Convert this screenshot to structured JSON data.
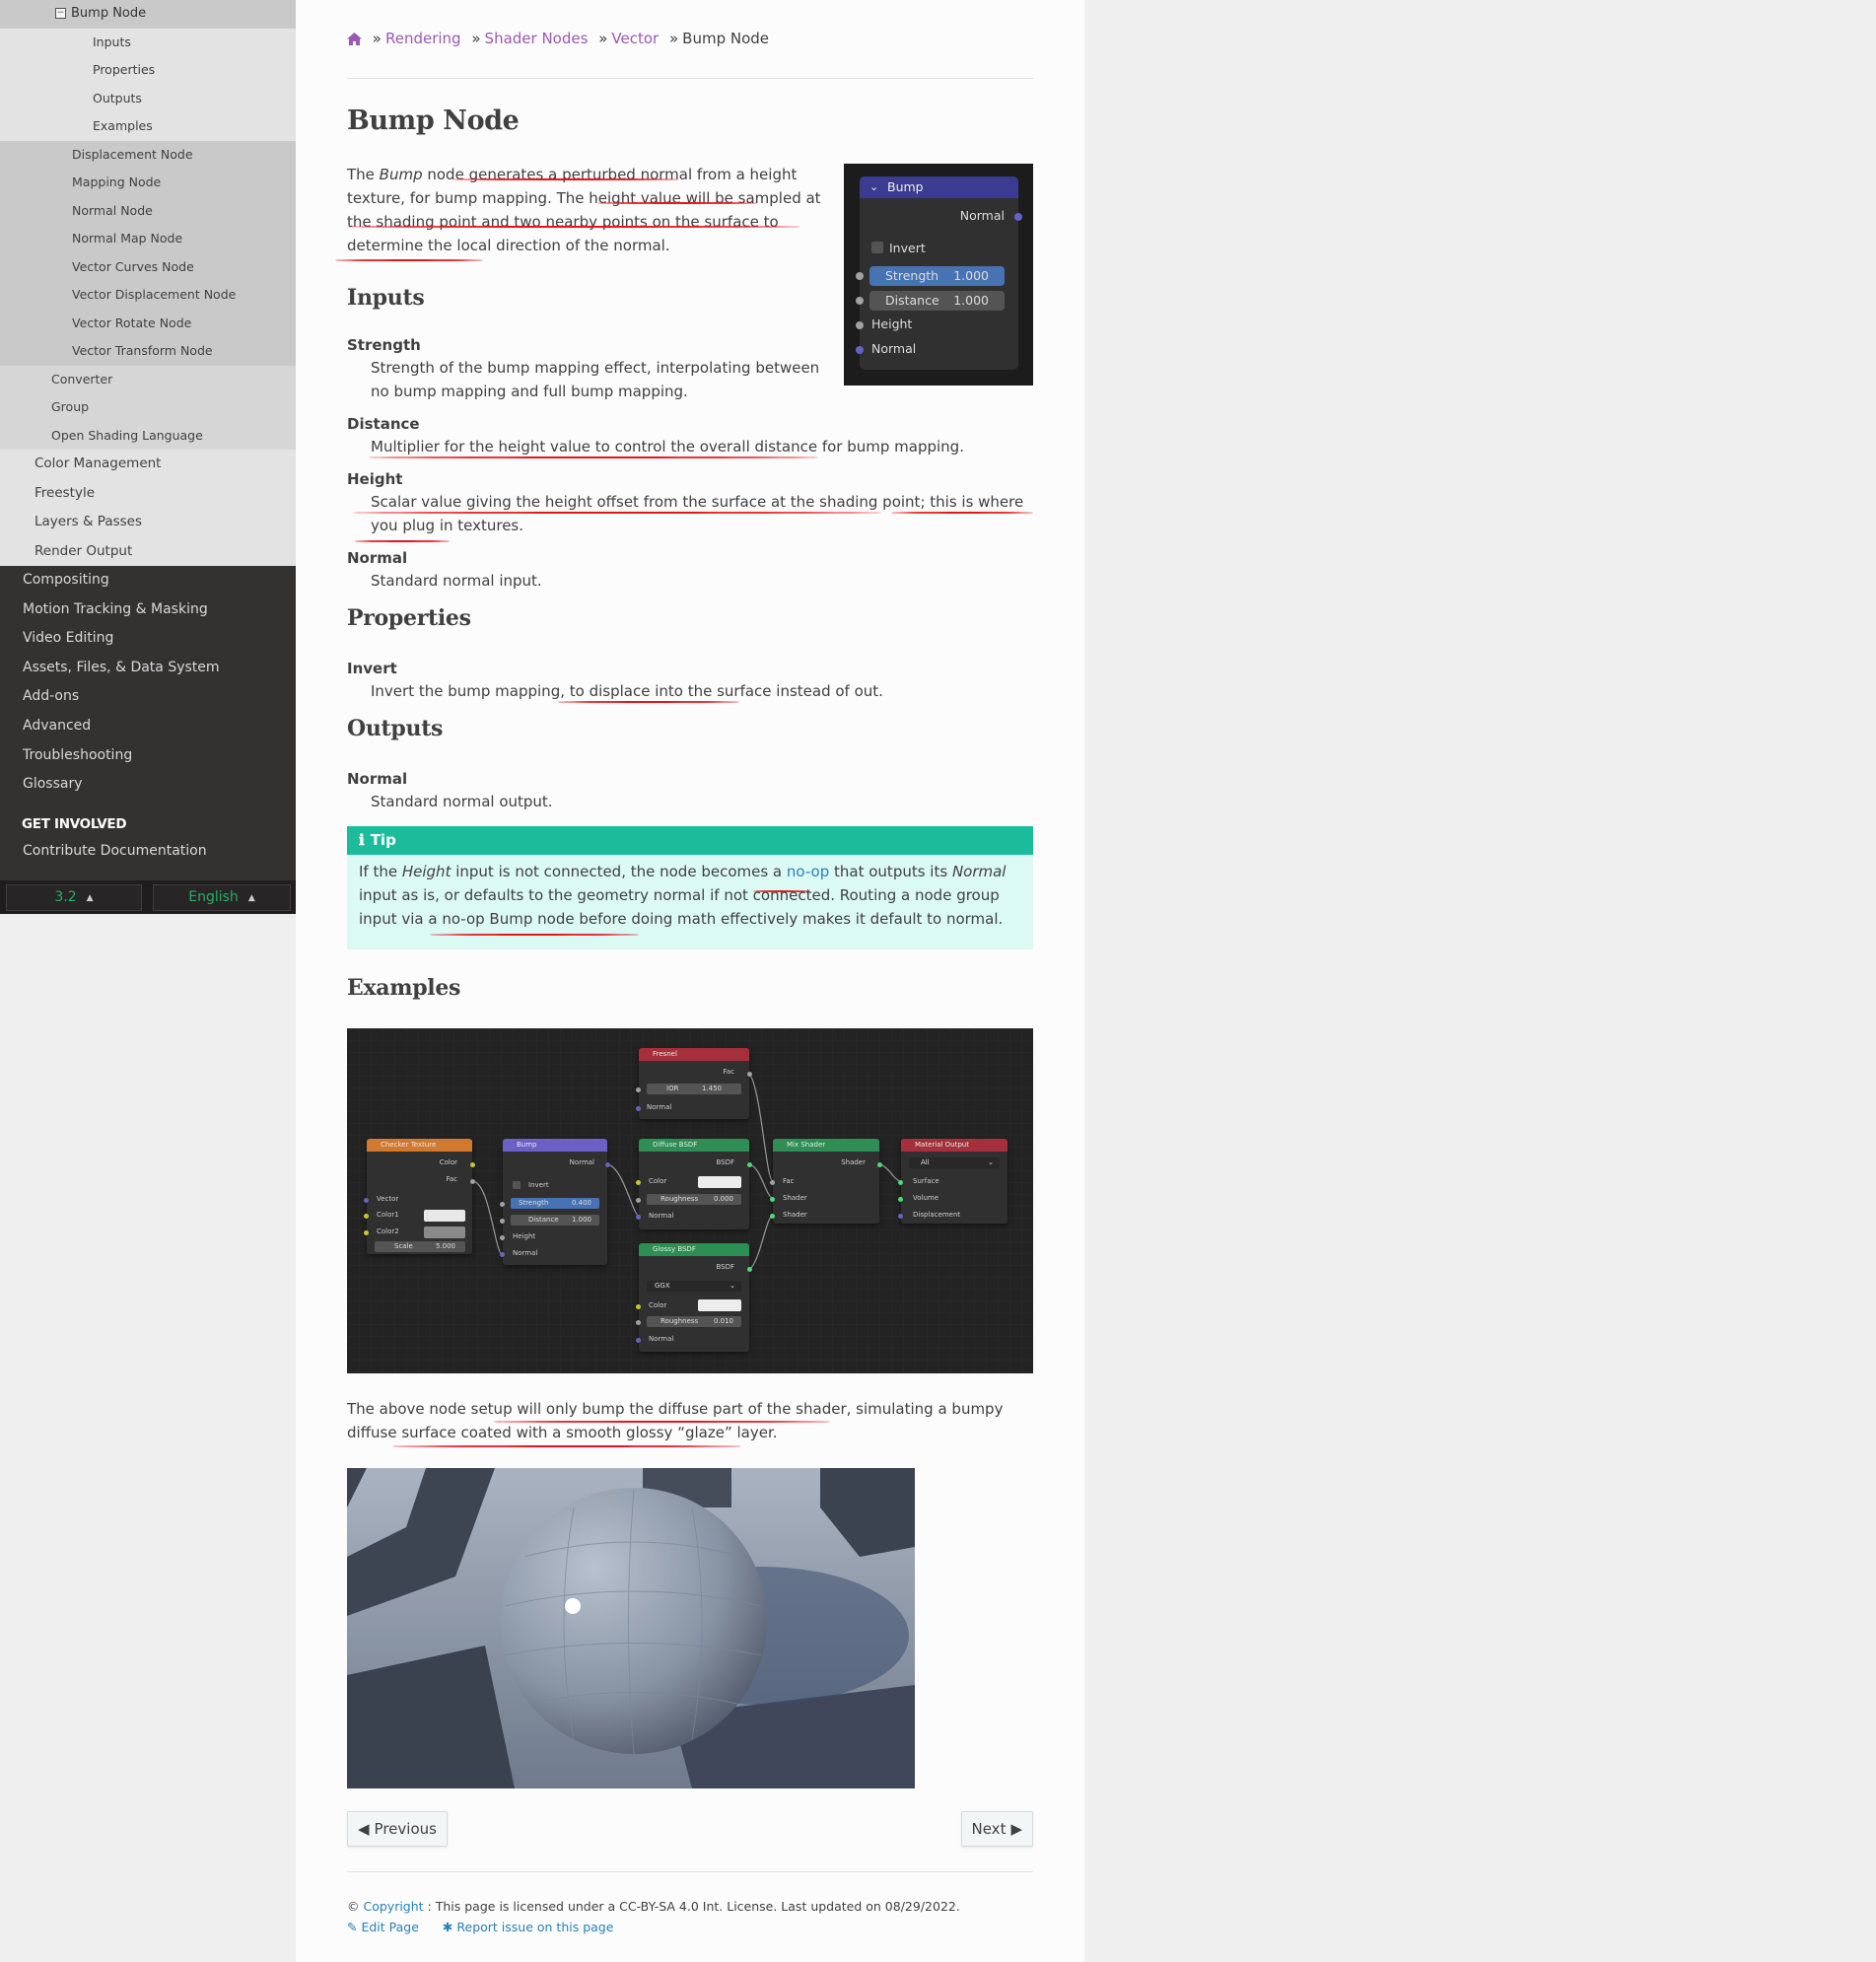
{
  "sidebar": {
    "current": "Bump Node",
    "sub_items": [
      "Inputs",
      "Properties",
      "Outputs",
      "Examples"
    ],
    "sibling_items": [
      "Displacement Node",
      "Mapping Node",
      "Normal Node",
      "Normal Map Node",
      "Vector Curves Node",
      "Vector Displacement Node",
      "Vector Rotate Node",
      "Vector Transform Node"
    ],
    "level2_items": [
      "Converter",
      "Group",
      "Open Shading Language"
    ],
    "level1_items": [
      "Color Management",
      "Freestyle",
      "Layers & Passes",
      "Render Output"
    ],
    "top_items": [
      "Compositing",
      "Motion Tracking & Masking",
      "Video Editing",
      "Assets, Files, & Data System",
      "Add-ons",
      "Advanced",
      "Troubleshooting",
      "Glossary"
    ],
    "caption": "GET INVOLVED",
    "contribute": "Contribute Documentation",
    "version": "3.2",
    "language": "English"
  },
  "breadcrumb": {
    "items": [
      "Rendering",
      "Shader Nodes",
      "Vector"
    ],
    "separator": "»",
    "current": "Bump Node"
  },
  "page": {
    "title": "Bump Node",
    "intro": {
      "pre": "The ",
      "em": "Bump",
      "post": " node generates a perturbed normal from a height texture, for bump mapping. The height value will be sampled at the shading point and two nearby points on the surface to determine the local direction of the normal."
    },
    "inputs_heading": "Inputs",
    "inputs": [
      {
        "term": "Strength",
        "def": "Strength of the bump mapping effect, interpolating between no bump mapping and full bump mapping."
      },
      {
        "term": "Distance",
        "def": "Multiplier for the height value to control the overall distance for bump mapping."
      },
      {
        "term": "Height",
        "def": "Scalar value giving the height offset from the surface at the shading point; this is where you plug in textures."
      },
      {
        "term": "Normal",
        "def": "Standard normal input."
      }
    ],
    "properties_heading": "Properties",
    "properties": [
      {
        "term": "Invert",
        "def": "Invert the bump mapping, to displace into the surface instead of out."
      }
    ],
    "outputs_heading": "Outputs",
    "outputs": [
      {
        "term": "Normal",
        "def": "Standard normal output."
      }
    ],
    "tip": {
      "title": "Tip",
      "t1": "If the ",
      "em1": "Height",
      "t2": " input is not connected, the node becomes a ",
      "link": "no-op",
      "t3": " that outputs its ",
      "em2": "Normal",
      "t4": " input as is, or defaults to the geometry normal if not connected. Routing a node group input via a no-op Bump node before doing math effectively makes it default to normal."
    },
    "examples_heading": "Examples",
    "examples_text": "The above node setup will only bump the diffuse part of the shader, simulating a bumpy diffuse surface coated with a smooth glossy “glaze” layer."
  },
  "bump_node_image": {
    "title": "Bump",
    "output": "Normal",
    "invert": "Invert",
    "strength_label": "Strength",
    "strength_value": "1.000",
    "distance_label": "Distance",
    "distance_value": "1.000",
    "height": "Height",
    "normal": "Normal",
    "header_color": "#3b3b8f",
    "socket_vector": "#6363c7",
    "socket_float": "#a1a1a1"
  },
  "example_nodes": {
    "fresnel": {
      "title": "Fresnel",
      "out": "Fac",
      "ior_label": "IOR",
      "ior_value": "1.450",
      "normal": "Normal"
    },
    "checker": {
      "title": "Checker Texture",
      "out1": "Color",
      "out2": "Fac",
      "vector": "Vector",
      "color1": "Color1",
      "color2": "Color2",
      "scale_label": "Scale",
      "scale_value": "5.000"
    },
    "bump": {
      "title": "Bump",
      "out": "Normal",
      "invert": "Invert",
      "strength_label": "Strength",
      "strength_value": "0.400",
      "distance_label": "Distance",
      "distance_value": "1.000",
      "height": "Height",
      "normal": "Normal"
    },
    "diffuse": {
      "title": "Diffuse BSDF",
      "out": "BSDF",
      "color": "Color",
      "rough_label": "Roughness",
      "rough_value": "0.000",
      "normal": "Normal"
    },
    "glossy": {
      "title": "Glossy BSDF",
      "out": "BSDF",
      "dist": "GGX",
      "color": "Color",
      "rough_label": "Roughness",
      "rough_value": "0.010",
      "normal": "Normal"
    },
    "mix": {
      "title": "Mix Shader",
      "out": "Shader",
      "fac": "Fac",
      "shader1": "Shader",
      "shader2": "Shader"
    },
    "output": {
      "title": "Material Output",
      "target": "All",
      "surface": "Surface",
      "volume": "Volume",
      "displacement": "Displacement"
    }
  },
  "nav": {
    "previous": "Previous",
    "next": "Next"
  },
  "footer": {
    "copyright_symbol": "©",
    "copyright_link": "Copyright",
    "license_text": ": This page is licensed under a CC-BY-SA 4.0 Int. License. Last updated on 08/29/2022.",
    "edit": "Edit Page",
    "report": "Report issue on this page"
  },
  "colors": {
    "link": "#9b59b6",
    "link_blue": "#2980b9",
    "tip_header": "#1abc9c",
    "tip_bg": "#dbfaf4",
    "annotation": "#e8141c"
  }
}
